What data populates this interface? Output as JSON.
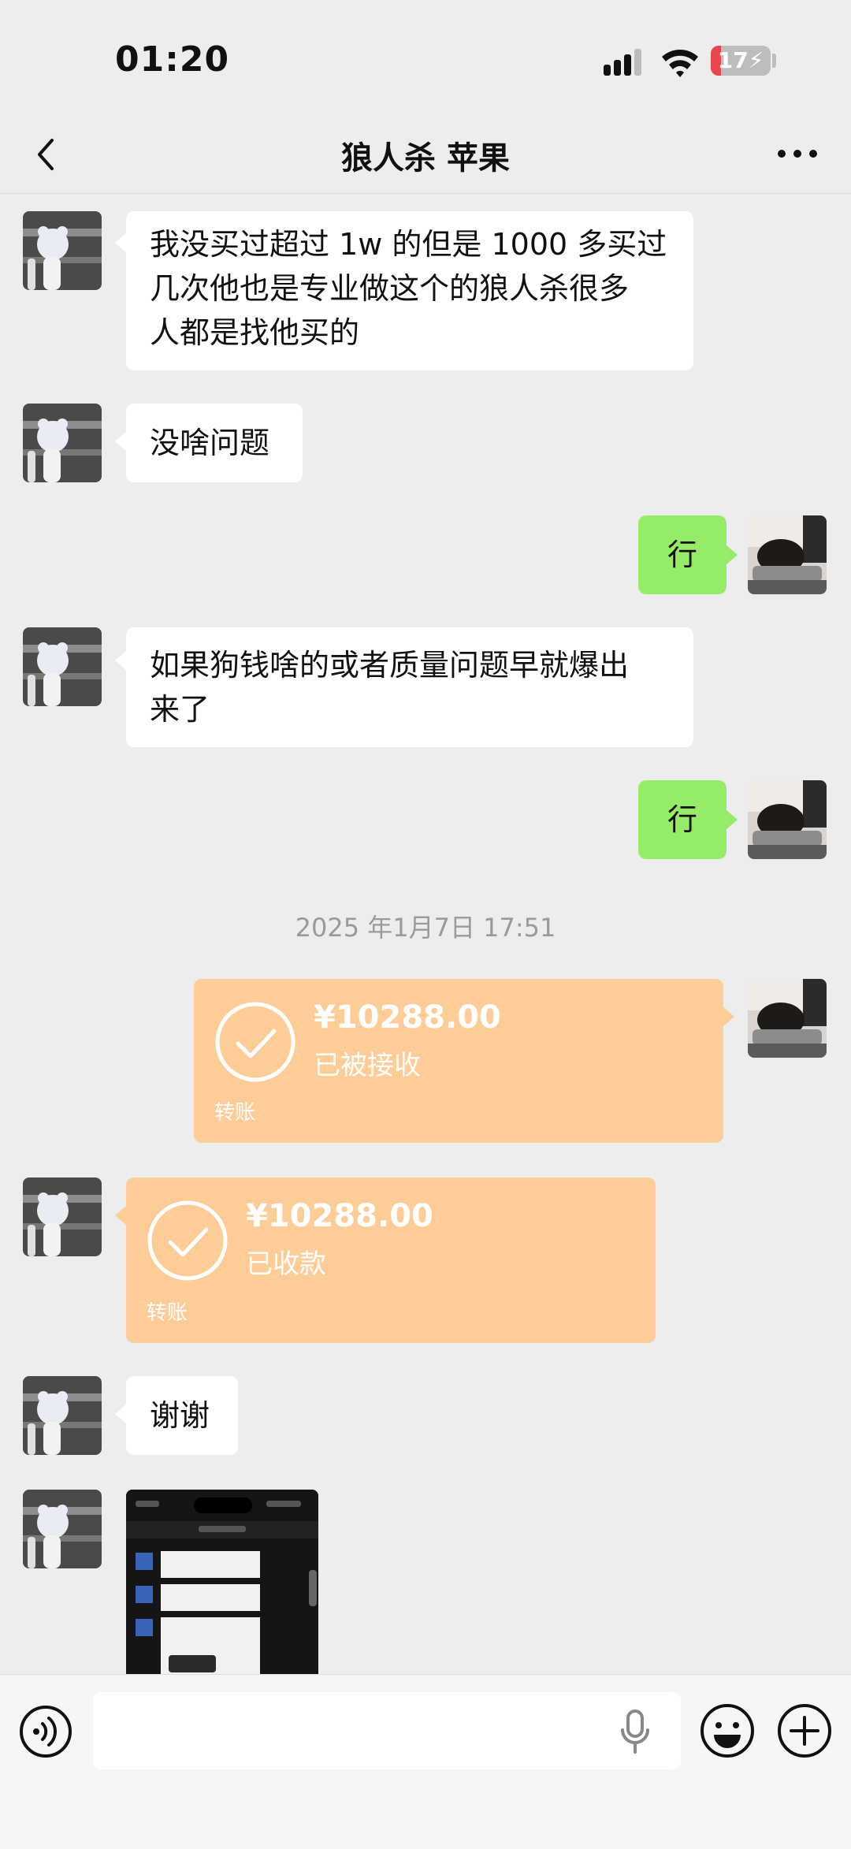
{
  "status_bar": {
    "time": "01:20",
    "battery": "17",
    "battery_fraction": 0.17
  },
  "nav": {
    "title": "狼人杀 苹果"
  },
  "messages": [
    {
      "type": "text",
      "side": "in",
      "lines": [
        "我没买过超过 1w 的但是 1000 多买过",
        "几次他也是专业做这个的狼人杀很多",
        "人都是找他买的"
      ]
    },
    {
      "type": "text",
      "side": "in",
      "lines": [
        "没啥问题"
      ]
    },
    {
      "type": "text",
      "side": "out",
      "lines": [
        "行"
      ]
    },
    {
      "type": "text",
      "side": "in",
      "lines": [
        "如果狗钱啥的或者质量问题早就爆出",
        "来了"
      ]
    },
    {
      "type": "text",
      "side": "out",
      "lines": [
        "行"
      ]
    },
    {
      "type": "timestamp",
      "text": "2025 年1月7日 17:51"
    },
    {
      "type": "transfer",
      "side": "out",
      "amount": "¥10288.00",
      "status": "已被接收",
      "kind": "转账"
    },
    {
      "type": "transfer",
      "side": "in",
      "amount": "¥10288.00",
      "status": "已收款",
      "kind": "转账"
    },
    {
      "type": "text",
      "side": "in",
      "lines": [
        "谢谢"
      ]
    },
    {
      "type": "image",
      "side": "in"
    }
  ],
  "colors": {
    "background": "#ededed",
    "incoming_bubble": "#ffffff",
    "outgoing_bubble": "#95ec69",
    "transfer": "#fecc96",
    "timestamp": "#9a9a9a"
  },
  "icons": {
    "back": "chevron-left-icon",
    "more": "more-dots-icon",
    "voice": "voice-wave-icon",
    "mic": "microphone-icon",
    "emoji": "emoji-smile-icon",
    "plus": "plus-circle-icon",
    "transfer": "check-circle-icon"
  }
}
